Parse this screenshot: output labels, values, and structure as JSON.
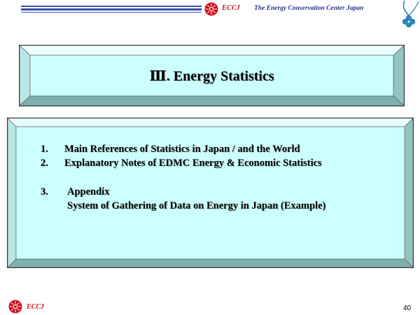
{
  "header": {
    "org_abbr": "ECCJ",
    "org_name": "The Energy Conservation Center Japan"
  },
  "title": "Ⅲ.  Energy Statistics",
  "contents": [
    {
      "number": "1.",
      "text": "Main References of Statistics in Japan / and the World"
    },
    {
      "number": "2.",
      "text": "Explanatory Notes of EDMC Energy & Economic Statistics"
    },
    {
      "number": "3.",
      "text": "Appendix",
      "subtext": "System of Gathering of Data on Energy in Japan (Example)"
    }
  ],
  "footer": {
    "org_abbr": "ECCJ",
    "page_number": "40"
  },
  "colors": {
    "panel_fill": "#ccffff",
    "header_line": "#3a4fb0",
    "logo_red": "#d0121b",
    "org_name_blue": "#26328c",
    "clover": "#2a87b8"
  },
  "icons": [
    "eccj-sun-logo-icon",
    "clover-icon"
  ]
}
